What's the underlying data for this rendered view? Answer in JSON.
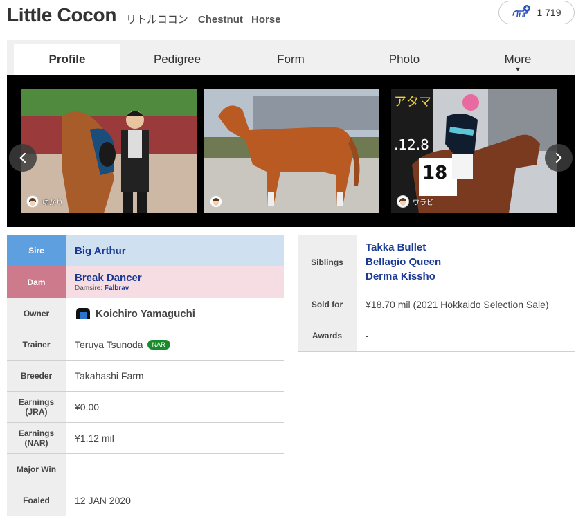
{
  "header": {
    "name": "Little Cocon",
    "kana": "リトルココン",
    "color": "Chestnut",
    "sex": "Horse",
    "fav_count": "1 719"
  },
  "tabs": [
    {
      "label": "Profile",
      "active": true
    },
    {
      "label": "Pedigree",
      "active": false
    },
    {
      "label": "Form",
      "active": false
    },
    {
      "label": "Photo",
      "active": false
    },
    {
      "label": "More",
      "active": false,
      "caret": "▼"
    }
  ],
  "gallery": {
    "photos": [
      {
        "credit": "ゆかり"
      },
      {
        "credit": ""
      },
      {
        "credit": "ワラビ"
      }
    ]
  },
  "left_table": {
    "sire": {
      "label": "Sire",
      "value": "Big Arthur"
    },
    "dam": {
      "label": "Dam",
      "value": "Break Dancer",
      "damsire_label": "Damsire:",
      "damsire": "Falbrav"
    },
    "owner": {
      "label": "Owner",
      "value": "Koichiro Yamaguchi"
    },
    "trainer": {
      "label": "Trainer",
      "value": "Teruya Tsunoda",
      "badge": "NAR"
    },
    "breeder": {
      "label": "Breeder",
      "value": "Takahashi Farm"
    },
    "earnings_jra": {
      "label1": "Earnings",
      "label2": "(JRA)",
      "value": "¥0.00"
    },
    "earnings_nar": {
      "label1": "Earnings",
      "label2": "(NAR)",
      "value": "¥1.12 mil"
    },
    "major_win": {
      "label": "Major Win",
      "value": ""
    },
    "foaled": {
      "label": "Foaled",
      "value": "12 JAN 2020"
    }
  },
  "right_table": {
    "siblings": {
      "label": "Siblings",
      "values": [
        "Takka Bullet",
        "Bellagio Queen",
        "Derma Kissho"
      ]
    },
    "sold_for": {
      "label": "Sold for",
      "value": "¥18.70 mil (2021 Hokkaido Selection Sale)"
    },
    "awards": {
      "label": "Awards",
      "value": "-"
    }
  },
  "colors": {
    "sire_header": "#5e9fdf",
    "sire_cell": "#cfe1f1",
    "dam_header": "#cd7a8c",
    "dam_cell": "#f5dde3",
    "link": "#1a3a94",
    "nar_badge": "#1a8a2c"
  }
}
